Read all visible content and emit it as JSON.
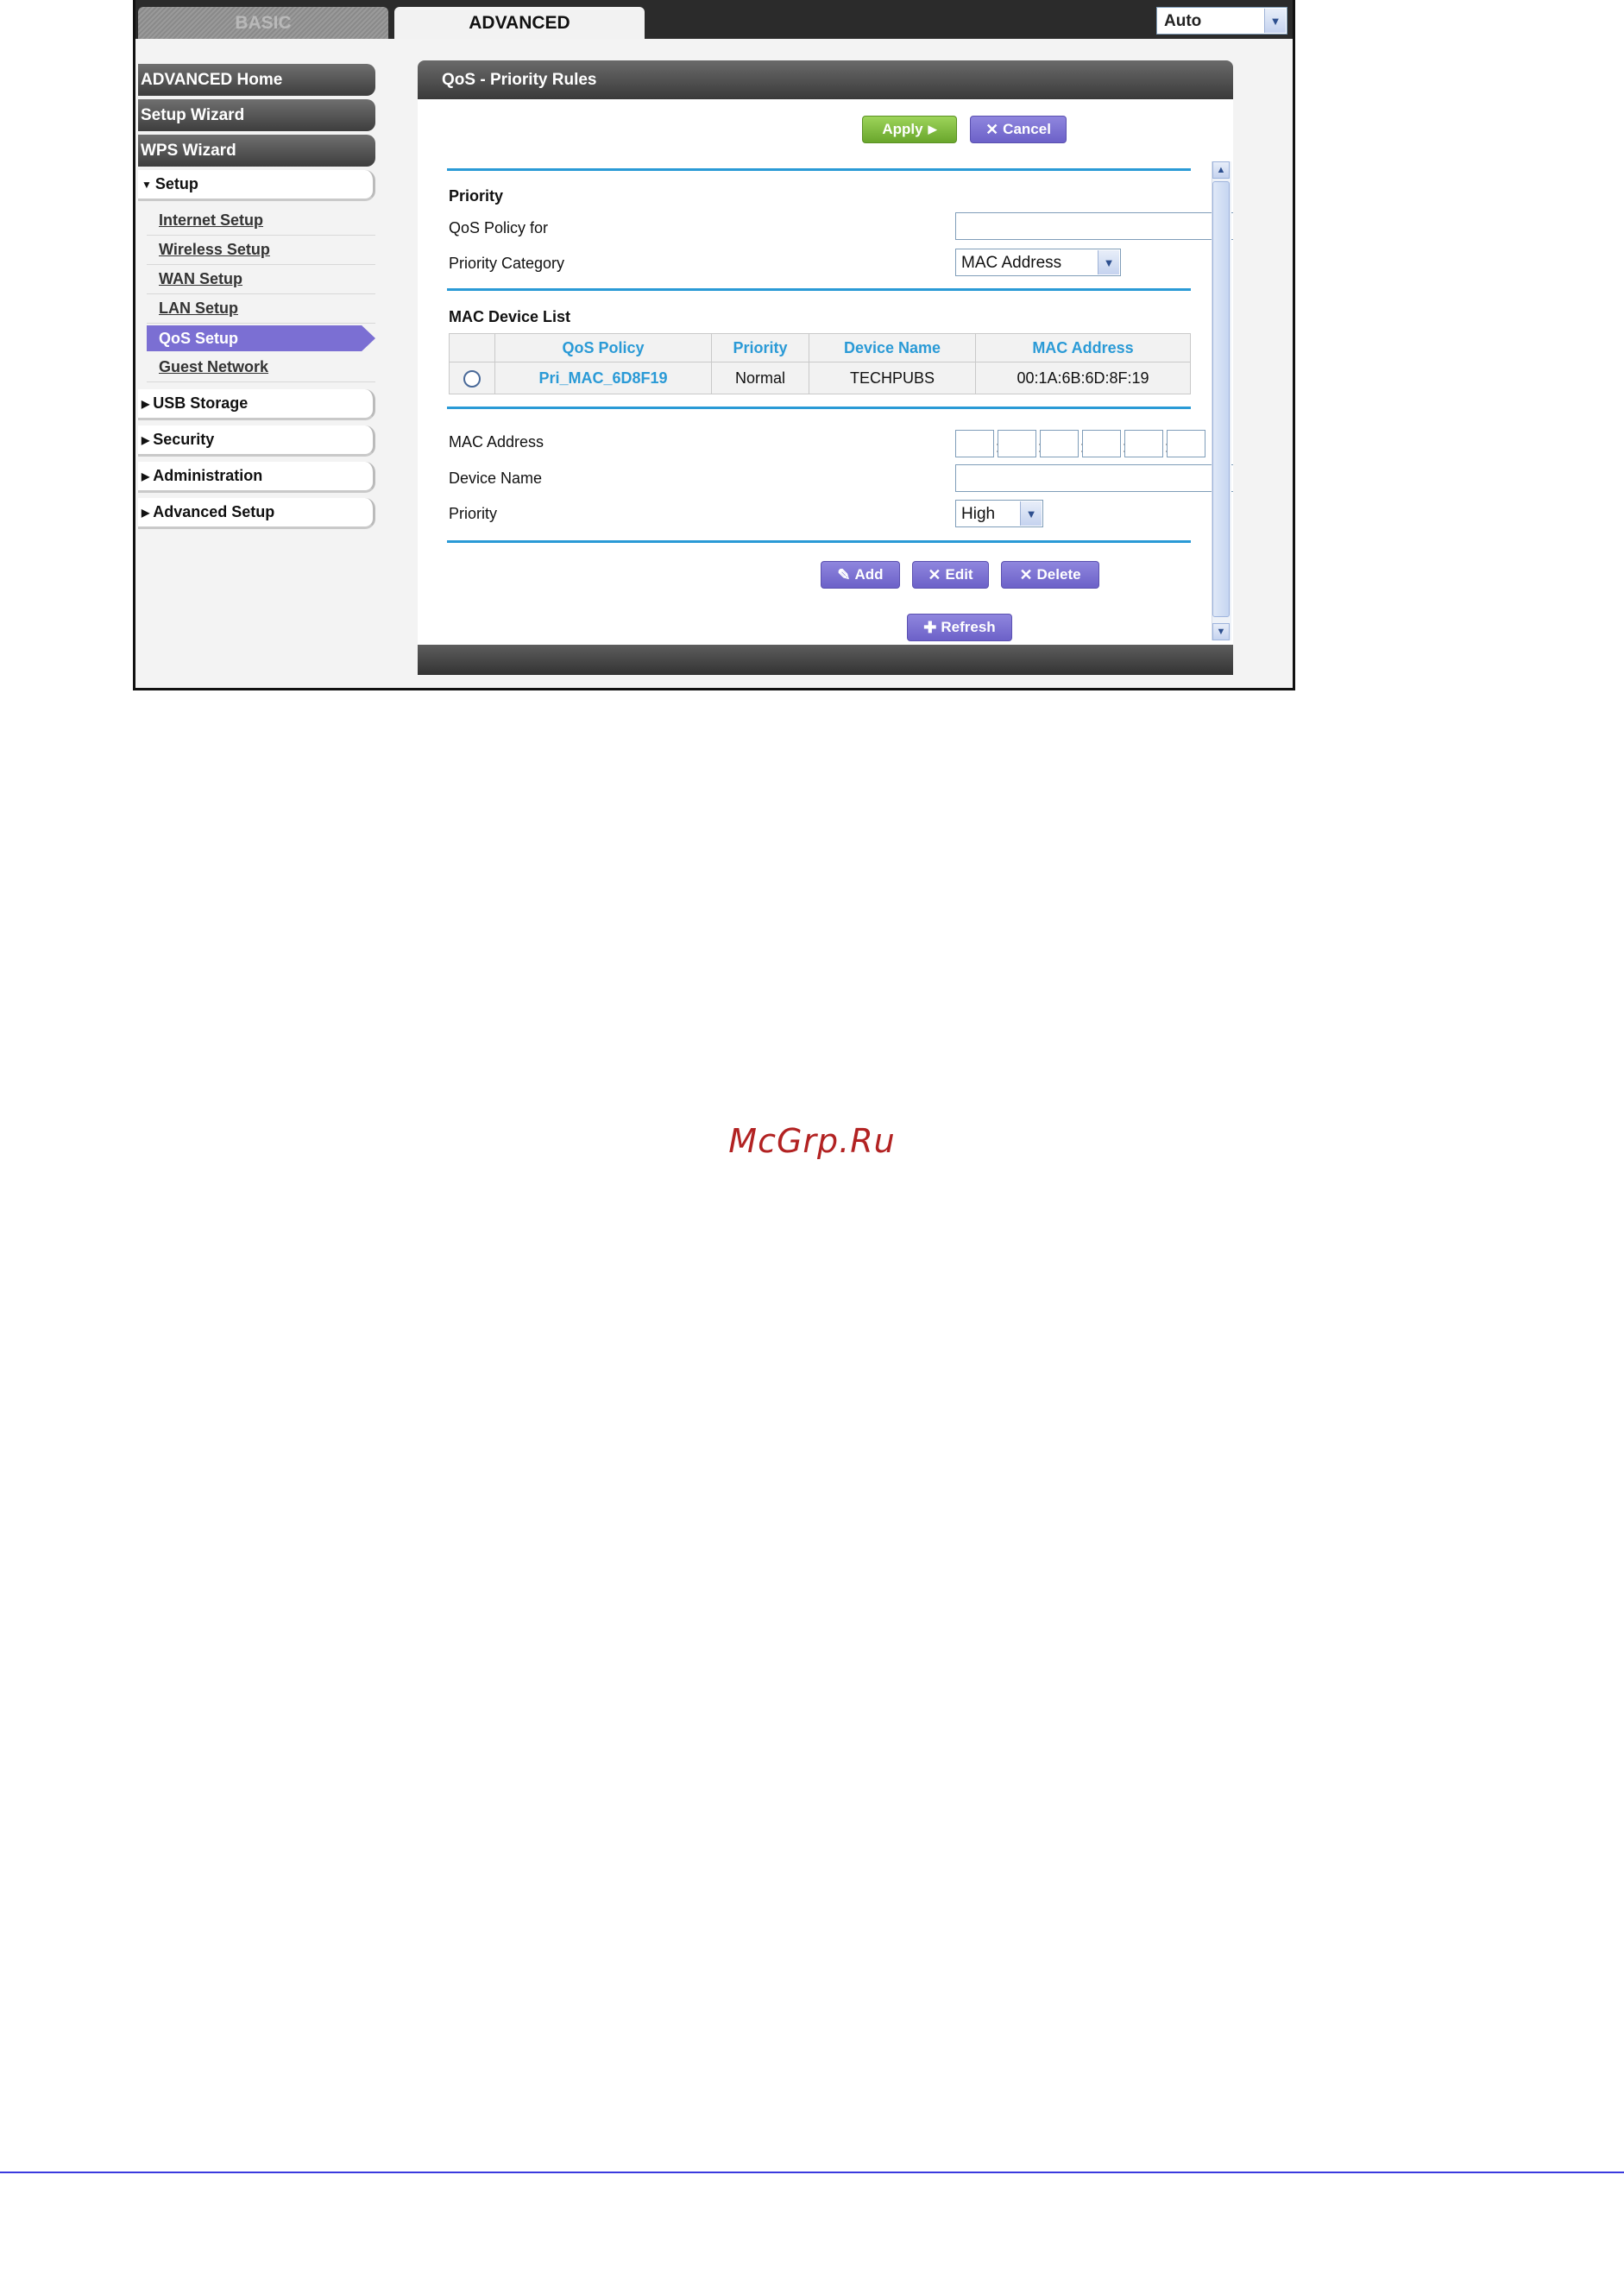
{
  "top_tabs": {
    "basic": "BASIC",
    "advanced": "ADVANCED"
  },
  "language_select": {
    "value": "Auto"
  },
  "sidebar": {
    "advanced_home": "ADVANCED Home",
    "setup_wizard": "Setup Wizard",
    "wps_wizard": "WPS Wizard",
    "setup": "Setup",
    "setup_items": [
      "Internet Setup",
      "Wireless Setup",
      "WAN Setup",
      "LAN Setup",
      "QoS Setup",
      "Guest Network"
    ],
    "usb_storage": "USB Storage",
    "security": "Security",
    "administration": "Administration",
    "advanced_setup": "Advanced Setup"
  },
  "panel": {
    "title": "QoS - Priority Rules",
    "apply_label": "Apply",
    "cancel_label": "Cancel",
    "priority_section": "Priority",
    "qos_policy_for_label": "QoS Policy for",
    "qos_policy_for_value": "",
    "priority_category_label": "Priority Category",
    "priority_category_value": "MAC Address",
    "mac_list_title": "MAC Device List",
    "table_headers": [
      "QoS Policy",
      "Priority",
      "Device Name",
      "MAC Address"
    ],
    "table_rows": [
      {
        "policy": "Pri_MAC_6D8F19",
        "priority": "Normal",
        "device": "TECHPUBS",
        "mac": "00:1A:6B:6D:8F:19"
      }
    ],
    "mac_address_label": "MAC Address",
    "device_name_label": "Device Name",
    "priority_label": "Priority",
    "priority_value": "High",
    "mac_separator": ":",
    "add_label": "Add",
    "edit_label": "Edit",
    "delete_label": "Delete",
    "refresh_label": "Refresh"
  },
  "watermark": "McGrp.Ru",
  "colors": {
    "accent_blue": "#2a9ad6",
    "active_purple": "#7b6fd3",
    "apply_green": "#7bb83a"
  }
}
